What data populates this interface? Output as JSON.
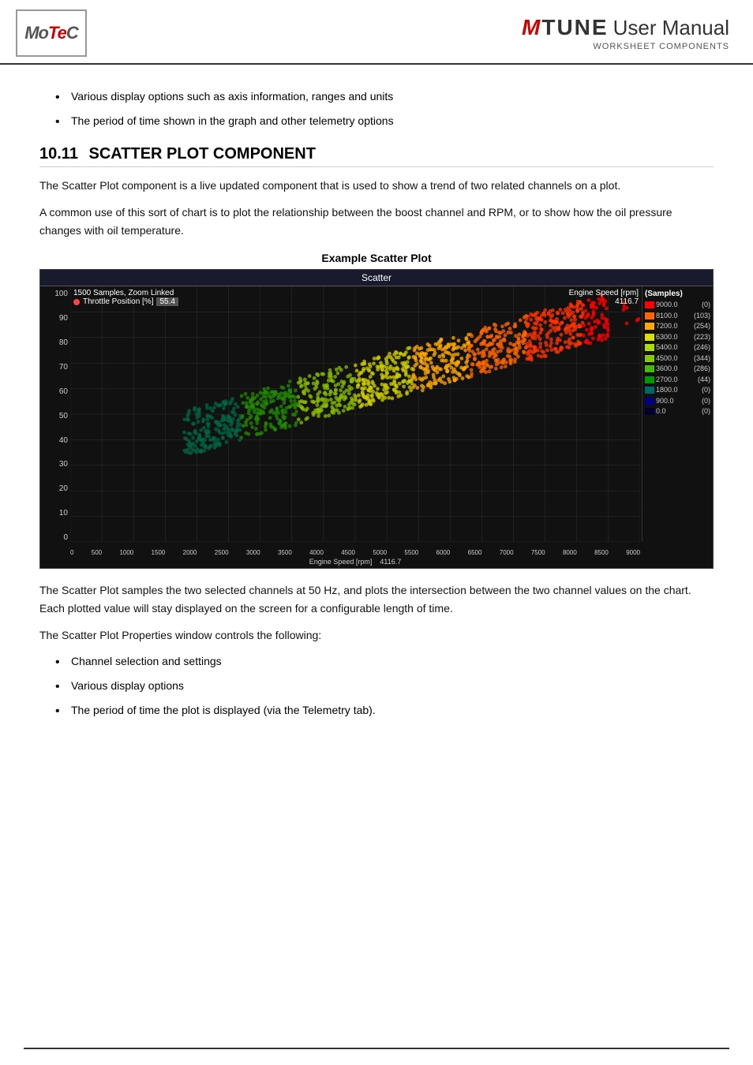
{
  "header": {
    "logo_text": "MoTeC",
    "mtune_m": "M",
    "mtune_tune": "TUNE",
    "manual_text": "User Manual",
    "subtitle": "WORKSHEET COMPONENTS"
  },
  "bullets_top": [
    "Various display options such as axis information, ranges and units",
    "The period of time shown in the graph and other telemetry options"
  ],
  "section": {
    "number": "10.11",
    "title": "SCATTER PLOT COMPONENT"
  },
  "paragraphs": [
    "The Scatter Plot component is a live updated component that is used to show a trend of two related channels on a plot.",
    "A common use of this sort of chart is to plot the relationship between the boost channel and RPM, or to show how the oil pressure changes with oil temperature."
  ],
  "chart": {
    "caption": "Example Scatter Plot",
    "title_bar": "Scatter",
    "top_left_info": "1500 Samples, Zoom Linked",
    "throttle_label": "Throttle Position [%]",
    "throttle_value": "55.4",
    "top_right_label": "Engine Speed [rpm]",
    "top_right_value": "4116.7",
    "y_labels": [
      "100",
      "90",
      "80",
      "70",
      "60",
      "50",
      "40",
      "30",
      "20",
      "10",
      "0"
    ],
    "x_labels": [
      "0",
      "500",
      "1000",
      "1500",
      "2000",
      "2500",
      "3000",
      "3500",
      "4000",
      "4500",
      "5000",
      "5500",
      "6000",
      "6500",
      "7000",
      "7500",
      "8000",
      "8500",
      "9000"
    ],
    "x_title": "Engine Speed [rpm]",
    "x_value": "4116.7",
    "legend_title": "(Samples)",
    "legend_items": [
      {
        "value": "9000.0",
        "count": "(0)",
        "color": "#ff0000"
      },
      {
        "value": "8100.0",
        "count": "(103)",
        "color": "#ff6600"
      },
      {
        "value": "7200.0",
        "count": "(254)",
        "color": "#ffaa00"
      },
      {
        "value": "6300.0",
        "count": "(223)",
        "color": "#dddd00"
      },
      {
        "value": "5400.0",
        "count": "(246)",
        "color": "#aadd00"
      },
      {
        "value": "4500.0",
        "count": "(344)",
        "color": "#88cc00"
      },
      {
        "value": "3600.0",
        "count": "(286)",
        "color": "#44bb00"
      },
      {
        "value": "2700.0",
        "count": "(44)",
        "color": "#009900"
      },
      {
        "value": "1800.0",
        "count": "(0)",
        "color": "#006666"
      },
      {
        "value": "900.0",
        "count": "(0)",
        "color": "#000088"
      },
      {
        "value": "0.0",
        "count": "(0)",
        "color": "#000033"
      }
    ]
  },
  "paragraphs_bottom": [
    "The Scatter Plot samples the two selected channels at 50 Hz, and plots the intersection between the two channel values on the chart. Each plotted value will stay displayed on the screen for a configurable length of time.",
    "The Scatter Plot Properties window controls the following:"
  ],
  "bullets_bottom": [
    "Channel selection and settings",
    "Various display options",
    "The period of time the plot is displayed (via the Telemetry tab)."
  ]
}
